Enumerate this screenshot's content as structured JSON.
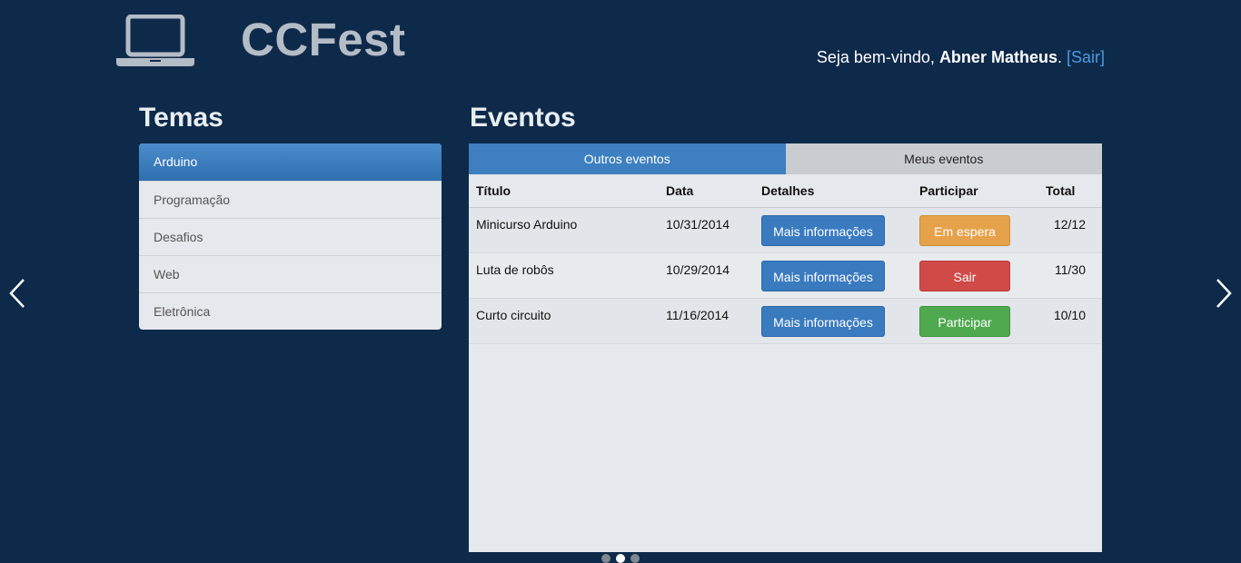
{
  "header": {
    "logo_icon": "laptop-icon",
    "title": "CCFest",
    "welcome_prefix": "Seja bem-vindo, ",
    "user_name": "Abner Matheus",
    "separator": ". ",
    "logout_label": "[Sair]"
  },
  "themes": {
    "heading": "Temas",
    "items": [
      {
        "label": "Arduino"
      },
      {
        "label": "Programação"
      },
      {
        "label": "Desafios"
      },
      {
        "label": "Web"
      },
      {
        "label": "Eletrônica"
      }
    ],
    "active_index": 0
  },
  "events": {
    "heading": "Eventos",
    "tabs": [
      {
        "label": "Outros eventos"
      },
      {
        "label": "Meus eventos"
      }
    ],
    "columns": {
      "title": "Título",
      "date": "Data",
      "details": "Detalhes",
      "participate": "Participar",
      "total": "Total"
    },
    "rows": [
      {
        "title": "Minicurso Arduino",
        "date": "10/31/2014",
        "details_label": "Mais informações",
        "action_label": "Em espera",
        "action_status": "warning",
        "total": "12/12"
      },
      {
        "title": "Luta de robôs",
        "date": "10/29/2014",
        "details_label": "Mais informações",
        "action_label": "Sair",
        "action_status": "danger",
        "total": "11/30"
      },
      {
        "title": "Curto circuito",
        "date": "11/16/2014",
        "details_label": "Mais informações",
        "action_label": "Participar",
        "action_status": "success",
        "total": "10/10"
      }
    ]
  },
  "carousel": {
    "prev_icon": "chevron-left-icon",
    "next_icon": "chevron-right-icon",
    "slide_count": 3,
    "active_slide": 2
  },
  "colors": {
    "background": "#0e2a4a",
    "accent": "#3d7fc0",
    "warning": "#e5a24a",
    "danger": "#d04a48",
    "success": "#4faa4f"
  }
}
